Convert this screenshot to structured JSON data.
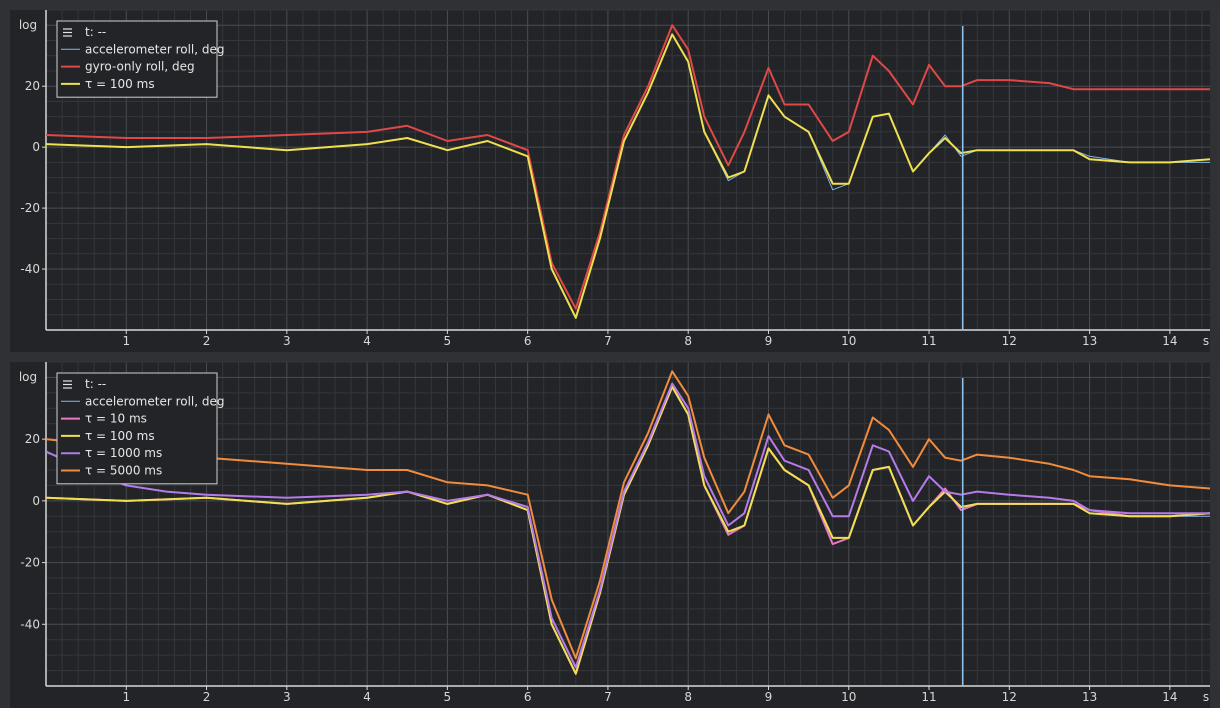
{
  "theme": {
    "page_bg": "#2f3134",
    "plot_bg": "#222427",
    "minor_grid": "#34373b",
    "major_grid": "#4a4d52",
    "axis": "#d8d8d8",
    "text": "#e6e6e6"
  },
  "chart_data": [
    {
      "type": "line",
      "ylabel": "log",
      "x_unit": "s",
      "xlim": [
        0,
        14.5
      ],
      "ylim": [
        -60,
        45
      ],
      "x_ticks": [
        1,
        2,
        3,
        4,
        5,
        6,
        7,
        8,
        9,
        10,
        11,
        12,
        13,
        14
      ],
      "y_ticks": [
        -40,
        -20,
        0,
        20
      ],
      "grid": true,
      "legend_position": "top-left",
      "legend_header": "t: --",
      "cursor_x": 11.42,
      "series": [
        {
          "name": "accelerometer roll, deg",
          "color": "#7fb8e8",
          "x": [
            0,
            1,
            2,
            3,
            4,
            4.5,
            5,
            5.5,
            6,
            6.3,
            6.6,
            6.9,
            7.2,
            7.5,
            7.8,
            8.0,
            8.2,
            8.5,
            8.7,
            9.0,
            9.2,
            9.5,
            9.8,
            10.0,
            10.3,
            10.5,
            10.8,
            11.0,
            11.2,
            11.4,
            11.6,
            12,
            12.5,
            12.8,
            13,
            13.5,
            14,
            14.5
          ],
          "y": [
            1,
            0,
            1,
            -1,
            1,
            3,
            -1,
            2,
            -3,
            -40,
            -56,
            -30,
            2,
            18,
            37,
            28,
            5,
            -11,
            -8,
            17,
            10,
            5,
            -14,
            -12,
            10,
            11,
            -8,
            -2,
            4,
            -3,
            -1,
            -1,
            -1,
            -1,
            -3,
            -5,
            -5,
            -5
          ]
        },
        {
          "name": "gyro-only roll, deg",
          "color": "#e04848",
          "x": [
            0,
            1,
            2,
            3,
            4,
            4.5,
            5,
            5.5,
            6,
            6.3,
            6.6,
            6.9,
            7.2,
            7.5,
            7.8,
            8.0,
            8.2,
            8.5,
            8.7,
            9.0,
            9.2,
            9.5,
            9.8,
            10.0,
            10.3,
            10.5,
            10.8,
            11.0,
            11.2,
            11.4,
            11.6,
            12,
            12.5,
            12.8,
            13,
            13.5,
            14,
            14.5
          ],
          "y": [
            4,
            3,
            3,
            4,
            5,
            7,
            2,
            4,
            -1,
            -38,
            -53,
            -28,
            4,
            20,
            40,
            32,
            10,
            -6,
            5,
            26,
            14,
            14,
            2,
            5,
            30,
            25,
            14,
            27,
            20,
            20,
            22,
            22,
            21,
            19,
            19,
            19,
            19,
            19
          ]
        },
        {
          "name": "τ = 100 ms",
          "color": "#f0e050",
          "x": [
            0,
            1,
            2,
            3,
            4,
            4.5,
            5,
            5.5,
            6,
            6.3,
            6.6,
            6.9,
            7.2,
            7.5,
            7.8,
            8.0,
            8.2,
            8.5,
            8.7,
            9.0,
            9.2,
            9.5,
            9.8,
            10.0,
            10.3,
            10.5,
            10.8,
            11.0,
            11.2,
            11.4,
            11.6,
            12,
            12.5,
            12.8,
            13,
            13.5,
            14,
            14.5
          ],
          "y": [
            1,
            0,
            1,
            -1,
            1,
            3,
            -1,
            2,
            -3,
            -40,
            -56,
            -30,
            2,
            18,
            37,
            28,
            5,
            -10,
            -8,
            17,
            10,
            5,
            -12,
            -12,
            10,
            11,
            -8,
            -2,
            3,
            -2,
            -1,
            -1,
            -1,
            -1,
            -4,
            -5,
            -5,
            -4
          ]
        }
      ]
    },
    {
      "type": "line",
      "ylabel": "log",
      "x_unit": "s",
      "xlim": [
        0,
        14.5
      ],
      "ylim": [
        -60,
        45
      ],
      "x_ticks": [
        1,
        2,
        3,
        4,
        5,
        6,
        7,
        8,
        9,
        10,
        11,
        12,
        13,
        14
      ],
      "y_ticks": [
        -40,
        -20,
        0,
        20
      ],
      "grid": true,
      "legend_position": "top-left",
      "legend_header": "t: --",
      "cursor_x": 11.42,
      "series": [
        {
          "name": "accelerometer roll, deg",
          "color": "#7fb8e8",
          "x": [
            0,
            1,
            2,
            3,
            4,
            4.5,
            5,
            5.5,
            6,
            6.3,
            6.6,
            6.9,
            7.2,
            7.5,
            7.8,
            8.0,
            8.2,
            8.5,
            8.7,
            9.0,
            9.2,
            9.5,
            9.8,
            10.0,
            10.3,
            10.5,
            10.8,
            11.0,
            11.2,
            11.4,
            11.6,
            12,
            12.5,
            12.8,
            13,
            13.5,
            14,
            14.5
          ],
          "y": [
            1,
            0,
            1,
            -1,
            1,
            3,
            -1,
            2,
            -3,
            -40,
            -56,
            -30,
            2,
            18,
            37,
            28,
            5,
            -11,
            -8,
            17,
            10,
            5,
            -14,
            -12,
            10,
            11,
            -8,
            -2,
            4,
            -3,
            -1,
            -1,
            -1,
            -1,
            -3,
            -5,
            -5,
            -5
          ]
        },
        {
          "name": "τ = 10 ms",
          "color": "#e878c8",
          "x": [
            0,
            1,
            2,
            3,
            4,
            4.5,
            5,
            5.5,
            6,
            6.3,
            6.6,
            6.9,
            7.2,
            7.5,
            7.8,
            8.0,
            8.2,
            8.5,
            8.7,
            9.0,
            9.2,
            9.5,
            9.8,
            10.0,
            10.3,
            10.5,
            10.8,
            11.0,
            11.2,
            11.4,
            11.6,
            12,
            12.5,
            12.8,
            13,
            13.5,
            14,
            14.5
          ],
          "y": [
            1,
            0,
            1,
            -1,
            1,
            3,
            -1,
            2,
            -3,
            -40,
            -56,
            -30,
            2,
            18,
            37,
            28,
            5,
            -11,
            -8,
            17,
            10,
            5,
            -14,
            -12,
            10,
            11,
            -8,
            -2,
            4,
            -3,
            -1,
            -1,
            -1,
            -1,
            -3,
            -5,
            -5,
            -4
          ]
        },
        {
          "name": "τ = 100 ms",
          "color": "#f0e050",
          "x": [
            0,
            1,
            2,
            3,
            4,
            4.5,
            5,
            5.5,
            6,
            6.3,
            6.6,
            6.9,
            7.2,
            7.5,
            7.8,
            8.0,
            8.2,
            8.5,
            8.7,
            9.0,
            9.2,
            9.5,
            9.8,
            10.0,
            10.3,
            10.5,
            10.8,
            11.0,
            11.2,
            11.4,
            11.6,
            12,
            12.5,
            12.8,
            13,
            13.5,
            14,
            14.5
          ],
          "y": [
            1,
            0,
            1,
            -1,
            1,
            3,
            -1,
            2,
            -3,
            -40,
            -56,
            -30,
            2,
            18,
            37,
            28,
            5,
            -10,
            -8,
            17,
            10,
            5,
            -12,
            -12,
            10,
            11,
            -8,
            -2,
            3,
            -2,
            -1,
            -1,
            -1,
            -1,
            -4,
            -5,
            -5,
            -4
          ]
        },
        {
          "name": "τ = 1000 ms",
          "color": "#b57ce8",
          "x": [
            0,
            0.5,
            1,
            1.5,
            2,
            3,
            4,
            4.5,
            5,
            5.5,
            6,
            6.3,
            6.6,
            6.9,
            7.2,
            7.5,
            7.8,
            8.0,
            8.2,
            8.5,
            8.7,
            9.0,
            9.2,
            9.5,
            9.8,
            10.0,
            10.3,
            10.5,
            10.8,
            11.0,
            11.2,
            11.4,
            11.6,
            12,
            12.5,
            12.8,
            13,
            13.5,
            14,
            14.5
          ],
          "y": [
            16,
            10,
            5,
            3,
            2,
            1,
            2,
            3,
            0,
            2,
            -2,
            -38,
            -54,
            -29,
            3,
            19,
            38,
            30,
            8,
            -8,
            -4,
            21,
            13,
            10,
            -5,
            -5,
            18,
            16,
            0,
            8,
            3,
            2,
            3,
            2,
            1,
            0,
            -3,
            -4,
            -4,
            -4
          ]
        },
        {
          "name": "τ = 5000 ms",
          "color": "#f08c3c",
          "x": [
            0,
            1,
            2,
            3,
            4,
            4.5,
            5,
            5.5,
            6,
            6.3,
            6.6,
            6.9,
            7.2,
            7.5,
            7.8,
            8.0,
            8.2,
            8.5,
            8.7,
            9.0,
            9.2,
            9.5,
            9.8,
            10.0,
            10.3,
            10.5,
            10.8,
            11.0,
            11.2,
            11.4,
            11.6,
            12,
            12.5,
            12.8,
            13,
            13.5,
            14,
            14.5
          ],
          "y": [
            20,
            17,
            14,
            12,
            10,
            10,
            6,
            5,
            2,
            -32,
            -51,
            -26,
            6,
            22,
            42,
            34,
            14,
            -4,
            3,
            28,
            18,
            15,
            1,
            5,
            27,
            23,
            11,
            20,
            14,
            13,
            15,
            14,
            12,
            10,
            8,
            7,
            5,
            4
          ]
        }
      ]
    }
  ]
}
